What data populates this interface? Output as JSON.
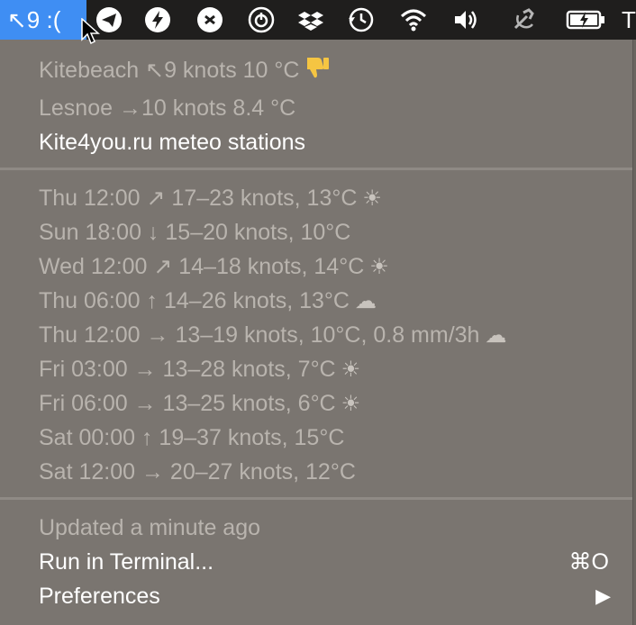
{
  "menubar": {
    "app_status": "↖9 :(",
    "truncated_text": "T",
    "icons": [
      "telegram-icon",
      "lightning-icon",
      "skype-icon",
      "power-icon",
      "dropbox-icon",
      "time-machine-icon",
      "wifi-icon",
      "volume-icon",
      "hammer-sickle-icon",
      "battery-charging-icon"
    ]
  },
  "stations": {
    "kitebeach": "Kitebeach ↖9 knots 10 °C",
    "lesnoe": "Lesnoe →10 knots 8.4 °C",
    "link": "Kite4you.ru meteo stations"
  },
  "forecast": [
    {
      "text": "Thu 12:00 ↗ 17–23 knots, 13°C",
      "icon": "☀"
    },
    {
      "text": "Sun 18:00 ↓ 15–20 knots, 10°C",
      "icon": ""
    },
    {
      "text": "Wed 12:00 ↗ 14–18 knots, 14°C",
      "icon": "☀"
    },
    {
      "text": "Thu 06:00 ↑ 14–26 knots, 13°C",
      "icon": "☁"
    },
    {
      "text": "Thu 12:00 → 13–19 knots, 10°C, 0.8 mm/3h",
      "icon": "☁"
    },
    {
      "text": "Fri 03:00 → 13–28 knots, 7°C",
      "icon": "☀"
    },
    {
      "text": "Fri 06:00 → 13–25 knots, 6°C",
      "icon": "☀"
    },
    {
      "text": "Sat 00:00 ↑ 19–37 knots, 15°C",
      "icon": ""
    },
    {
      "text": "Sat 12:00 → 20–27 knots, 12°C",
      "icon": ""
    }
  ],
  "footer": {
    "updated": "Updated a minute ago",
    "run_terminal": "Run in Terminal...",
    "run_shortcut": "⌘O",
    "preferences": "Preferences",
    "preferences_arrow": "▶"
  },
  "colors": {
    "menubar_bg": "#1f1e1d",
    "highlight": "#3f8ef3",
    "menu_bg": "#7a7570",
    "dim_text": "#b9b4ae",
    "thumb_emoji": "#f5c542"
  }
}
